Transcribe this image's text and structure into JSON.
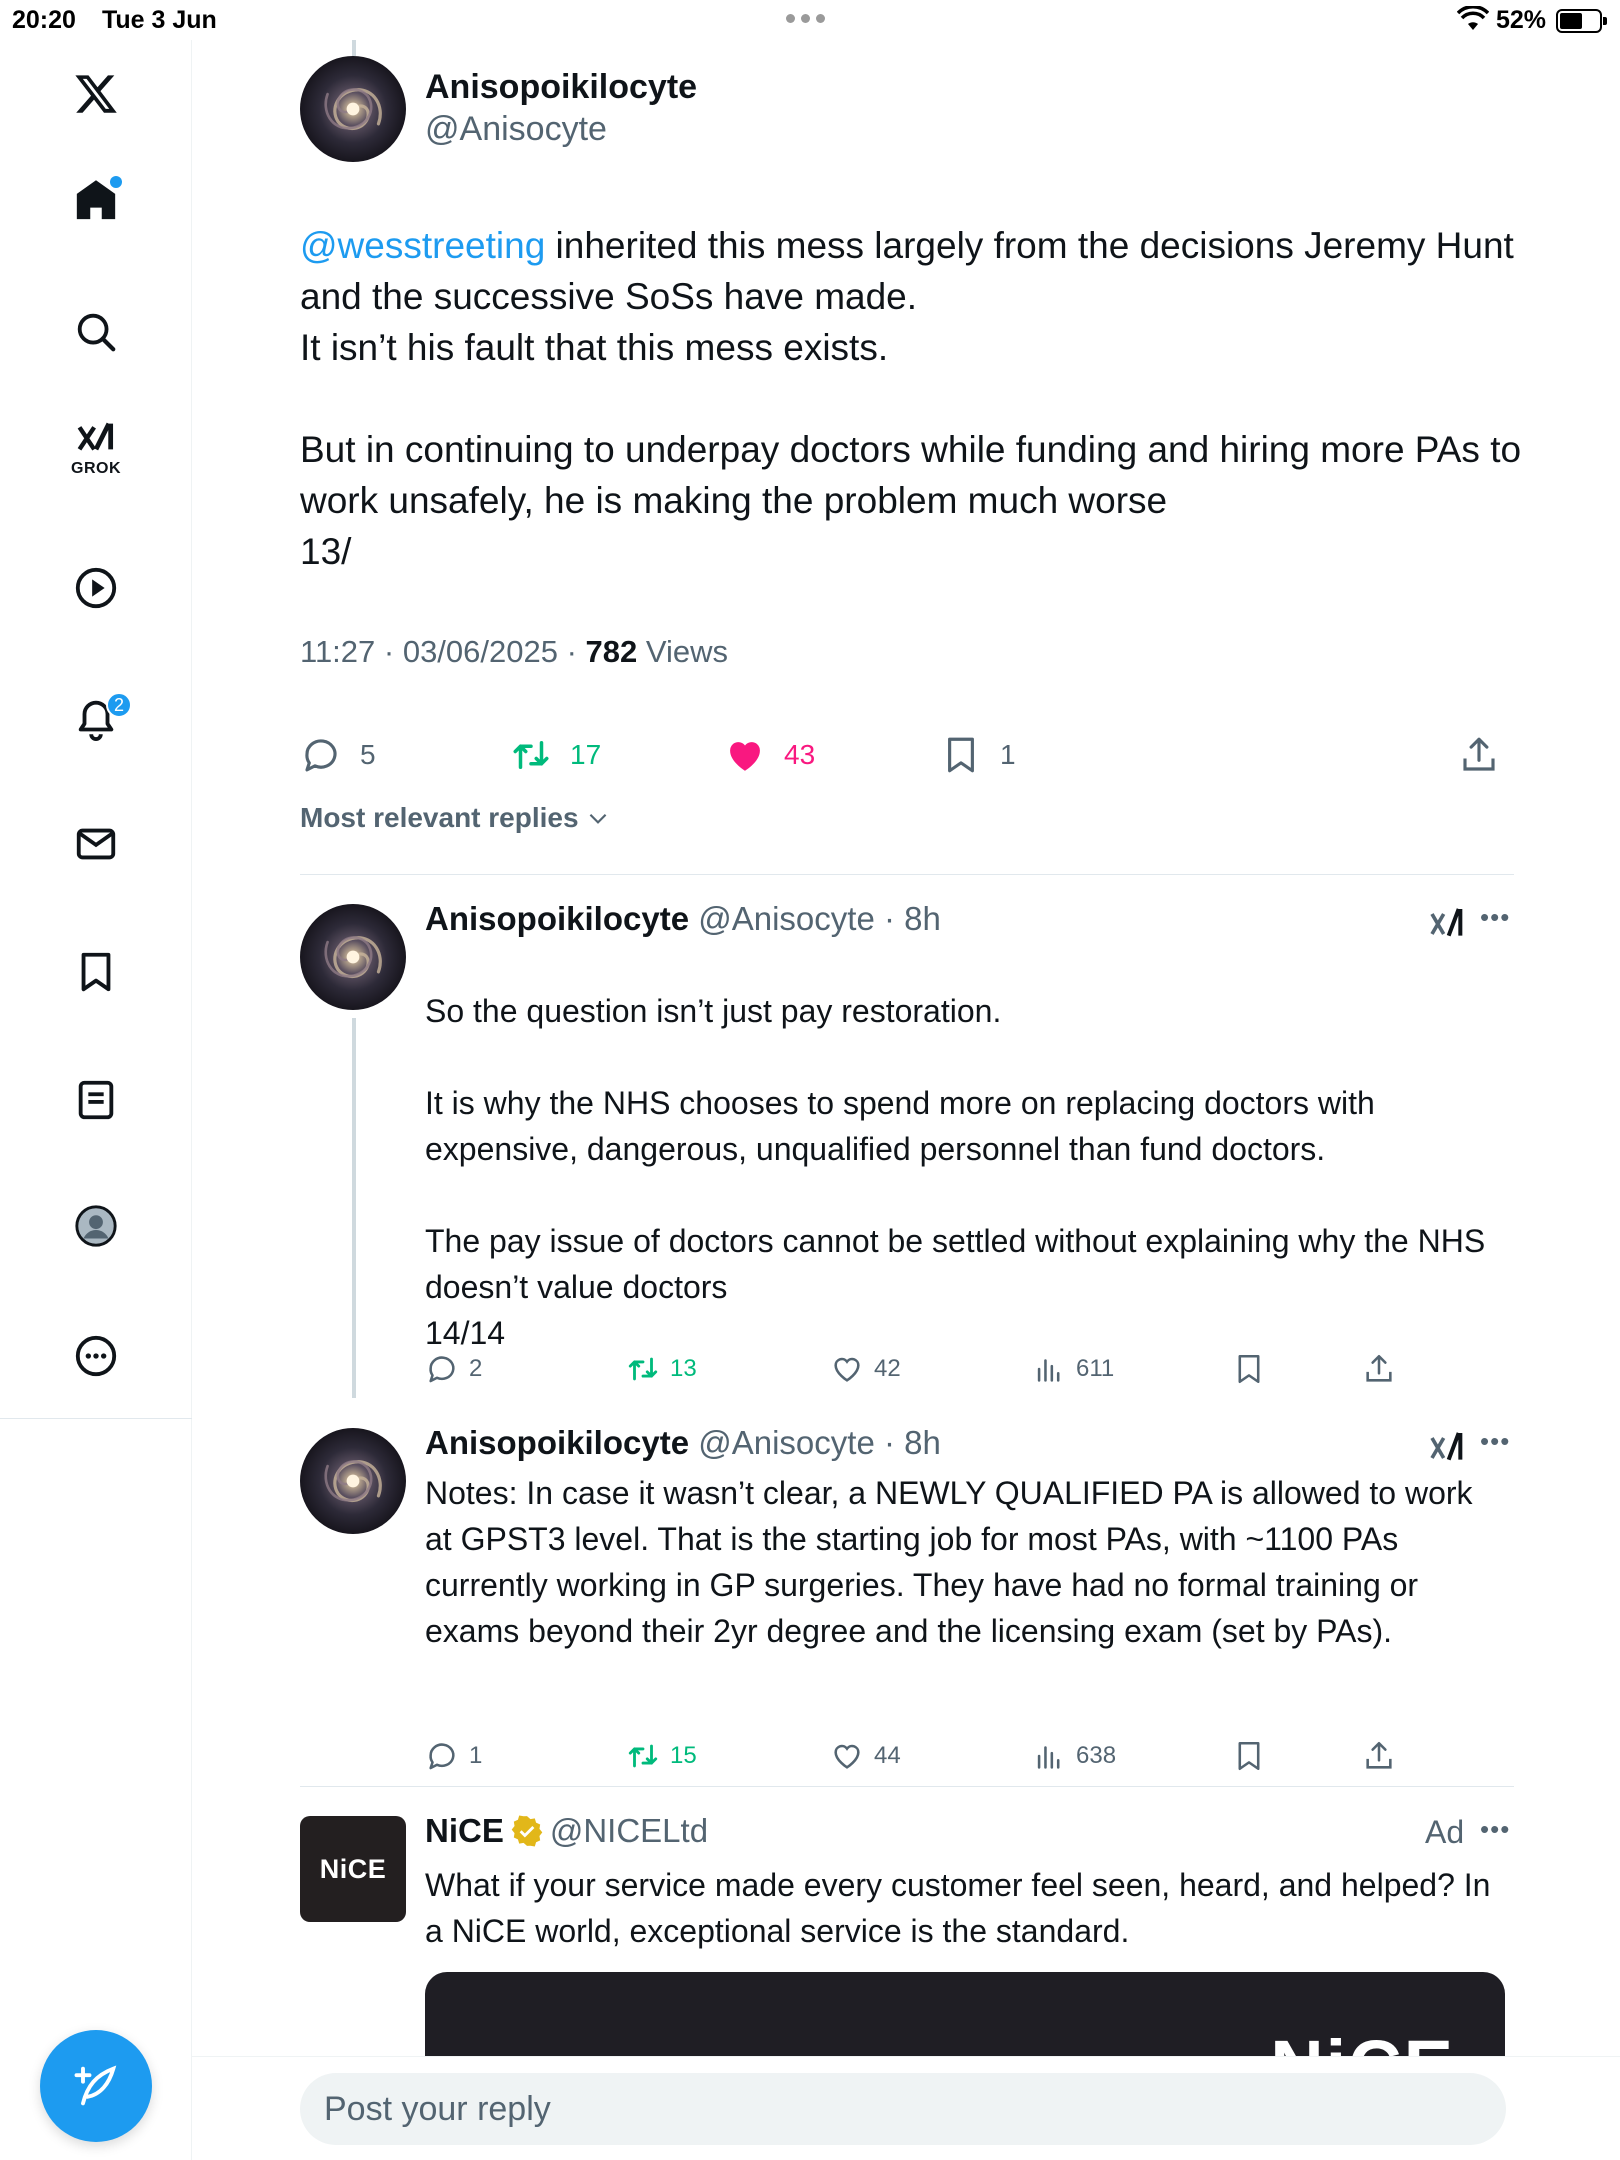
{
  "status_bar": {
    "time": "20:20",
    "date": "Tue 3 Jun",
    "battery": "52%"
  },
  "sidebar": {
    "notifications_badge": "2",
    "grok_label": "GROK"
  },
  "main_tweet": {
    "name": "Anisopoikilocyte",
    "handle": "@Anisocyte",
    "mention": "@wesstreeting",
    "text": " inherited this mess largely from the decisions Jeremy Hunt and the successive SoSs have made.\nIt isn’t his fault that this mess exists.\n\nBut in continuing to underpay doctors while funding and hiring more PAs to work unsafely, he is making the problem much worse\n13/",
    "timestamp": "11:27 · 03/06/2025 · ",
    "views_count": "782",
    "views_label": " Views",
    "replies": "5",
    "reposts": "17",
    "likes": "43",
    "bookmarks": "1"
  },
  "sort_label": "Most relevant replies",
  "replies": [
    {
      "name": "Anisopoikilocyte",
      "handle": " @Anisocyte · 8h",
      "text": "So the question isn’t just pay restoration.\n\nIt is why the NHS chooses to spend more on replacing doctors with expensive, dangerous, unqualified personnel than fund doctors.\n\nThe pay issue of doctors cannot be settled without explaining why the NHS doesn’t value doctors\n14/14",
      "replies": "2",
      "reposts": "13",
      "likes": "42",
      "views": "611"
    },
    {
      "name": "Anisopoikilocyte",
      "handle": " @Anisocyte · 8h",
      "text": "Notes: In case it wasn’t clear, a NEWLY QUALIFIED PA is allowed to work at GPST3 level. That is the starting job for most PAs, with ~1100 PAs currently working in GP surgeries. They have had no formal training or exams beyond their 2yr degree and the licensing exam (set by PAs).",
      "replies": "1",
      "reposts": "15",
      "likes": "44",
      "views": "638"
    }
  ],
  "ad": {
    "name": "NiCE",
    "handle": "@NICELtd",
    "label": "Ad",
    "logo_text": "NiCE",
    "text": "What if your service made every customer feel seen, heard, and helped? In a NiCE world, exceptional service is the standard.",
    "media_brand": "NiCE"
  },
  "reply_box": {
    "placeholder": "Post your reply"
  },
  "colors": {
    "accent": "#1d9bf0",
    "repost": "#00ba7c",
    "like": "#f91880",
    "muted": "#536471"
  }
}
